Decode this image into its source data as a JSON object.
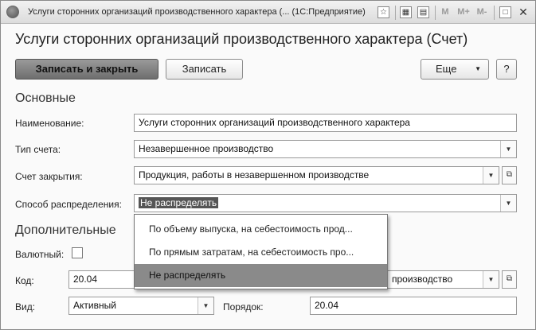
{
  "window": {
    "title": "Услуги сторонних организаций производственного характера (... (1С:Предприятие)",
    "titlebar_buttons": [
      "M",
      "M+",
      "M-"
    ]
  },
  "form": {
    "title": "Услуги сторонних организаций производственного характера (Счет)"
  },
  "toolbar": {
    "write_close_label": "Записать и закрыть",
    "write_label": "Записать",
    "more_label": "Еще",
    "help_label": "?"
  },
  "sections": {
    "main": "Основные",
    "additional": "Дополнительные"
  },
  "fields": {
    "name_label": "Наименование:",
    "name_value": "Услуги сторонних организаций производственного характера",
    "account_type_label": "Тип счета:",
    "account_type_value": "Незавершенное производство",
    "closing_account_label": "Счет закрытия:",
    "closing_account_value": "Продукция, работы в незавершенном производстве",
    "distribution_label": "Способ распределения:",
    "distribution_value": "Не распределять",
    "currency_label": "Валютный:",
    "code_label": "Код:",
    "code_value": "20.04",
    "right_field_value": "производство",
    "kind_label": "Вид:",
    "kind_value": "Активный",
    "order_label": "Порядок:",
    "order_value": "20.04"
  },
  "dropdown": {
    "options": [
      "По объему выпуска, на себестоимость прод...",
      "По прямым затратам, на себестоимость про...",
      "Не распределять"
    ],
    "selected_index": 2
  }
}
